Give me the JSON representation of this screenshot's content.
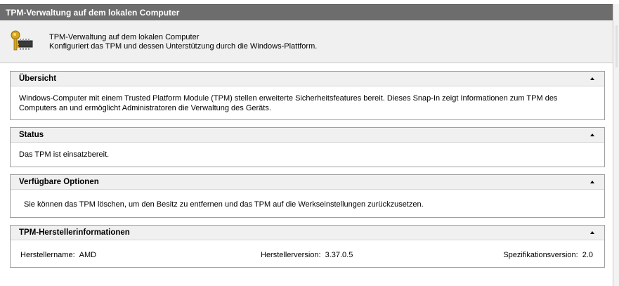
{
  "window": {
    "title": "TPM-Verwaltung auf dem lokalen Computer"
  },
  "header": {
    "icon": "key-chip-icon",
    "line1": "TPM-Verwaltung auf dem lokalen Computer",
    "line2": "Konfiguriert das TPM und dessen Unterstützung durch die Windows-Plattform."
  },
  "sections": {
    "overview": {
      "title": "Übersicht",
      "text": "Windows-Computer mit einem Trusted Platform Module (TPM) stellen erweiterte Sicherheitsfeatures bereit. Dieses Snap-In zeigt Informationen zum TPM des Computers an und ermöglicht Administratoren die Verwaltung des Geräts."
    },
    "status": {
      "title": "Status",
      "text": "Das TPM ist einsatzbereit."
    },
    "options": {
      "title": "Verfügbare Optionen",
      "text": "Sie können das TPM löschen, um den Besitz zu entfernen und das TPM auf die Werkseinstellungen zurückzusetzen."
    },
    "manufacturer": {
      "title": "TPM-Herstellerinformationen",
      "name_label": "Herstellername:",
      "name_value": "AMD",
      "version_label": "Herstellerversion:",
      "version_value": "3.37.0.5",
      "spec_label": "Spezifikationsversion:",
      "spec_value": "2.0"
    }
  }
}
